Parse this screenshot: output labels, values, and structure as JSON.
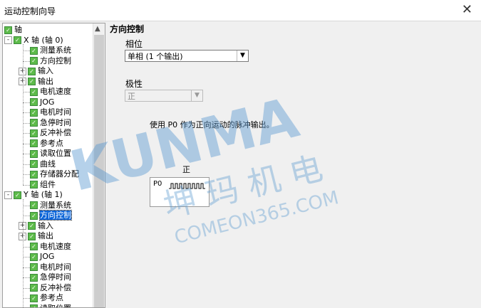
{
  "window": {
    "title": "运动控制向导",
    "close_glyph": "✕"
  },
  "tree": {
    "root": "轴",
    "x_axis": {
      "label": "X 轴 (轴 0)",
      "children": [
        "测量系统",
        "方向控制",
        "输入",
        "输出",
        "电机速度",
        "JOG",
        "电机时间",
        "急停时间",
        "反冲补偿",
        "参考点",
        "读取位置",
        "曲线",
        "存储器分配",
        "组件"
      ]
    },
    "y_axis": {
      "label": "Y 轴 (轴 1)",
      "children": [
        "测量系统",
        "方向控制",
        "输入",
        "输出",
        "电机速度",
        "JOG",
        "电机时间",
        "急停时间",
        "反冲补偿",
        "参考点",
        "读取位置"
      ]
    },
    "selected": "方向控制"
  },
  "panel": {
    "title": "方向控制",
    "phase_label": "相位",
    "phase_value": "单相 (1 个输出)",
    "polarity_label": "极性",
    "polarity_value": "正",
    "description": "使用 P0 作为正向运动的脉冲输出。",
    "diagram_caption": "正",
    "diagram_signal": "P0"
  },
  "watermark": {
    "brand": "KUNMA",
    "chinese": "坤 玛 机 电",
    "site": "COMEON365.COM"
  },
  "colors": {
    "selection": "#0a64d8",
    "checkbox": "#5dbb4a",
    "watermark": "#5c9ad0"
  }
}
